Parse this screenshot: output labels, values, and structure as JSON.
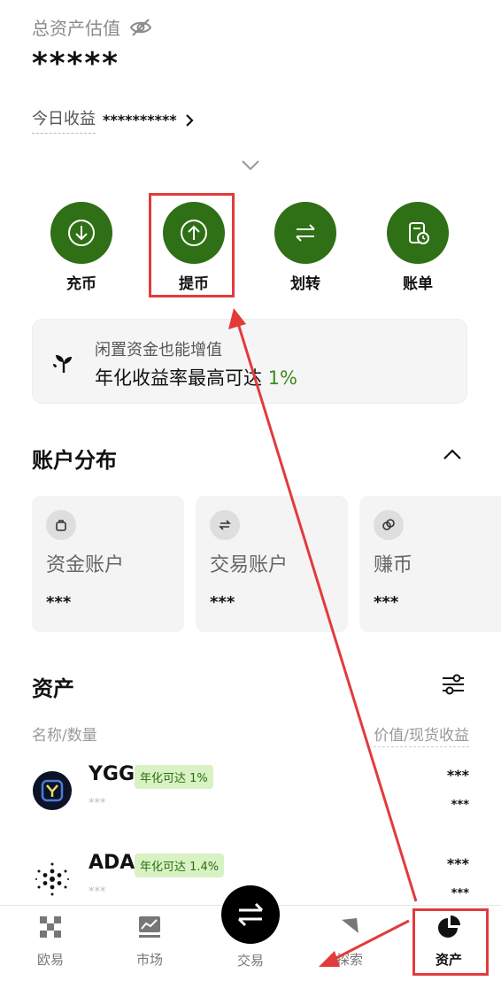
{
  "header": {
    "total_label": "总资产估值",
    "total_value": "*****",
    "today_label": "今日收益",
    "today_value": "**********"
  },
  "actions": [
    {
      "label": "充币",
      "icon": "deposit-icon"
    },
    {
      "label": "提币",
      "icon": "withdraw-icon"
    },
    {
      "label": "划转",
      "icon": "transfer-icon"
    },
    {
      "label": "账单",
      "icon": "bill-icon"
    }
  ],
  "promo": {
    "line1": "闲置资金也能增值",
    "line2_prefix": "年化收益率最高可达",
    "line2_pct": "1%"
  },
  "distribution": {
    "title": "账户分布",
    "cards": [
      {
        "name": "资金账户",
        "value": "***"
      },
      {
        "name": "交易账户",
        "value": "***"
      },
      {
        "name": "赚币",
        "value": "***"
      }
    ]
  },
  "assets": {
    "title": "资产",
    "col_left": "名称/数量",
    "col_right": "价值/现货收益",
    "rows": [
      {
        "symbol": "YGG",
        "badge": "年化可达 1%",
        "sub": "***",
        "value": "***",
        "pnl": "***"
      },
      {
        "symbol": "ADA",
        "badge": "年化可达 1.4%",
        "sub": "***",
        "value": "***",
        "pnl": "***"
      }
    ]
  },
  "nav": {
    "items": [
      {
        "label": "欧易",
        "icon": "okx-logo-icon"
      },
      {
        "label": "市场",
        "icon": "market-chart-icon"
      },
      {
        "label": "交易",
        "icon": "trade-swap-icon"
      },
      {
        "label": "探索",
        "icon": "explore-compass-icon"
      },
      {
        "label": "资产",
        "icon": "assets-pie-icon"
      }
    ]
  },
  "colors": {
    "accent_green": "#2f6f16",
    "badge_bg": "#d8f2c4",
    "annotation_red": "#e23b3b"
  }
}
